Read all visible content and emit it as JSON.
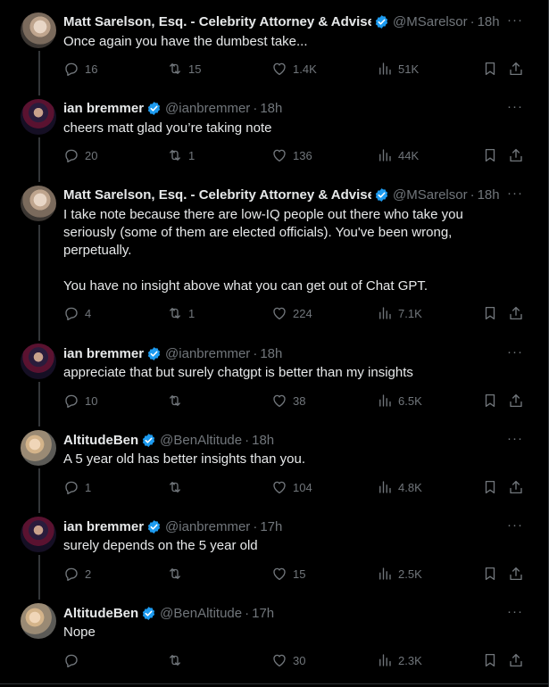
{
  "tweets": [
    {
      "name": "Matt Sarelson, Esq. - Celebrity Attorney & Advise",
      "handle": "@MSarelsor",
      "time": "18h",
      "text": "Once again you have the dumbest take...",
      "replies": "16",
      "retweets": "15",
      "likes": "1.4K",
      "views": "51K"
    },
    {
      "name": "ian bremmer",
      "handle": "@ianbremmer",
      "time": "18h",
      "text": "cheers matt glad you’re taking note",
      "replies": "20",
      "retweets": "1",
      "likes": "136",
      "views": "44K"
    },
    {
      "name": "Matt Sarelson, Esq. - Celebrity Attorney & Advise",
      "handle": "@MSarelsor",
      "time": "18h",
      "text": "I take note because there are low-IQ people out there who take you seriously (some of them are elected officials). You've been wrong, perpetually.\n\nYou have no insight above what you can get out of Chat GPT.",
      "replies": "4",
      "retweets": "1",
      "likes": "224",
      "views": "7.1K"
    },
    {
      "name": "ian bremmer",
      "handle": "@ianbremmer",
      "time": "18h",
      "text": "appreciate that but surely chatgpt is better than my insights",
      "replies": "10",
      "retweets": "",
      "likes": "38",
      "views": "6.5K"
    },
    {
      "name": "AltitudeBen",
      "handle": "@BenAltitude",
      "time": "18h",
      "text": "A 5 year old has better insights than you.",
      "replies": "1",
      "retweets": "",
      "likes": "104",
      "views": "4.8K"
    },
    {
      "name": "ian bremmer",
      "handle": "@ianbremmer",
      "time": "17h",
      "text": "surely depends on the 5 year old",
      "replies": "2",
      "retweets": "",
      "likes": "15",
      "views": "2.5K"
    },
    {
      "name": "AltitudeBen",
      "handle": "@BenAltitude",
      "time": "17h",
      "text": "Nope",
      "replies": "",
      "retweets": "",
      "likes": "30",
      "views": "2.3K"
    }
  ],
  "ui": {
    "more": "···",
    "dot": "·"
  },
  "colors": {
    "background": "#000000",
    "text": "#e7e9ea",
    "muted": "#71767b",
    "verified": "#1d9bf0",
    "divider": "#2f3336"
  },
  "icons": [
    "reply-icon",
    "retweet-icon",
    "like-icon",
    "views-icon",
    "bookmark-icon",
    "share-icon",
    "verified-badge-icon",
    "more-icon"
  ]
}
